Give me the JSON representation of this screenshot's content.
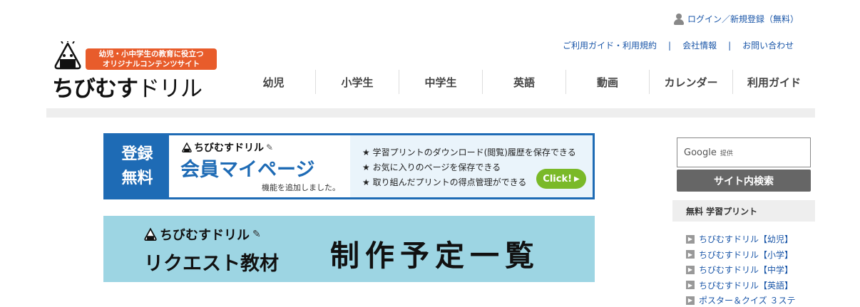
{
  "header": {
    "login_label": "ログイン／新規登録（無料）",
    "sublinks": [
      "ご利用ガイド・利用規約",
      "会社情報",
      "お問い合わせ"
    ],
    "separator": "|"
  },
  "logo": {
    "tagline_line1": "幼児・小中学生の教育に役立つ",
    "tagline_line2": "オリジナルコンテンツサイト",
    "name_bold": "ちびむす",
    "name_thin": "ドリル"
  },
  "nav": {
    "items": [
      "幼児",
      "小学生",
      "中学生",
      "英語",
      "動画",
      "カレンダー",
      "利用ガイド"
    ]
  },
  "member_banner": {
    "free_line1": "登録",
    "free_line2": "無料",
    "mini_logo": "ちびむすドリル",
    "title": "会員マイページ",
    "added_note": "機能を追加しました。",
    "features": [
      "★ 学習プリントのダウンロード(閲覧)履歴を保存できる",
      "★ お気に入りのページを保存できる",
      "★ 取り組んだプリントの得点管理ができる"
    ],
    "click_label": "Click!",
    "click_arrow": "▶"
  },
  "request_banner": {
    "mini_logo": "ちびむすドリル",
    "title": "リクエスト教材",
    "list_title": "制作予定一覧"
  },
  "sidebar": {
    "search_brand": "Google",
    "search_sub": "提供",
    "search_button": "サイト内検索",
    "section_title": "無料 学習プリント",
    "links": [
      "ちびむすドリル【幼児】",
      "ちびむすドリル【小学】",
      "ちびむすドリル【中学】",
      "ちびむすドリル【英語】",
      "ポスター＆クイズ ３ステ"
    ]
  },
  "colors": {
    "link": "#1a56a8",
    "brand_orange": "#e85c2b",
    "member_blue": "#1e6bb5",
    "click_green": "#7ab928",
    "request_bg": "#9dd5e3"
  }
}
